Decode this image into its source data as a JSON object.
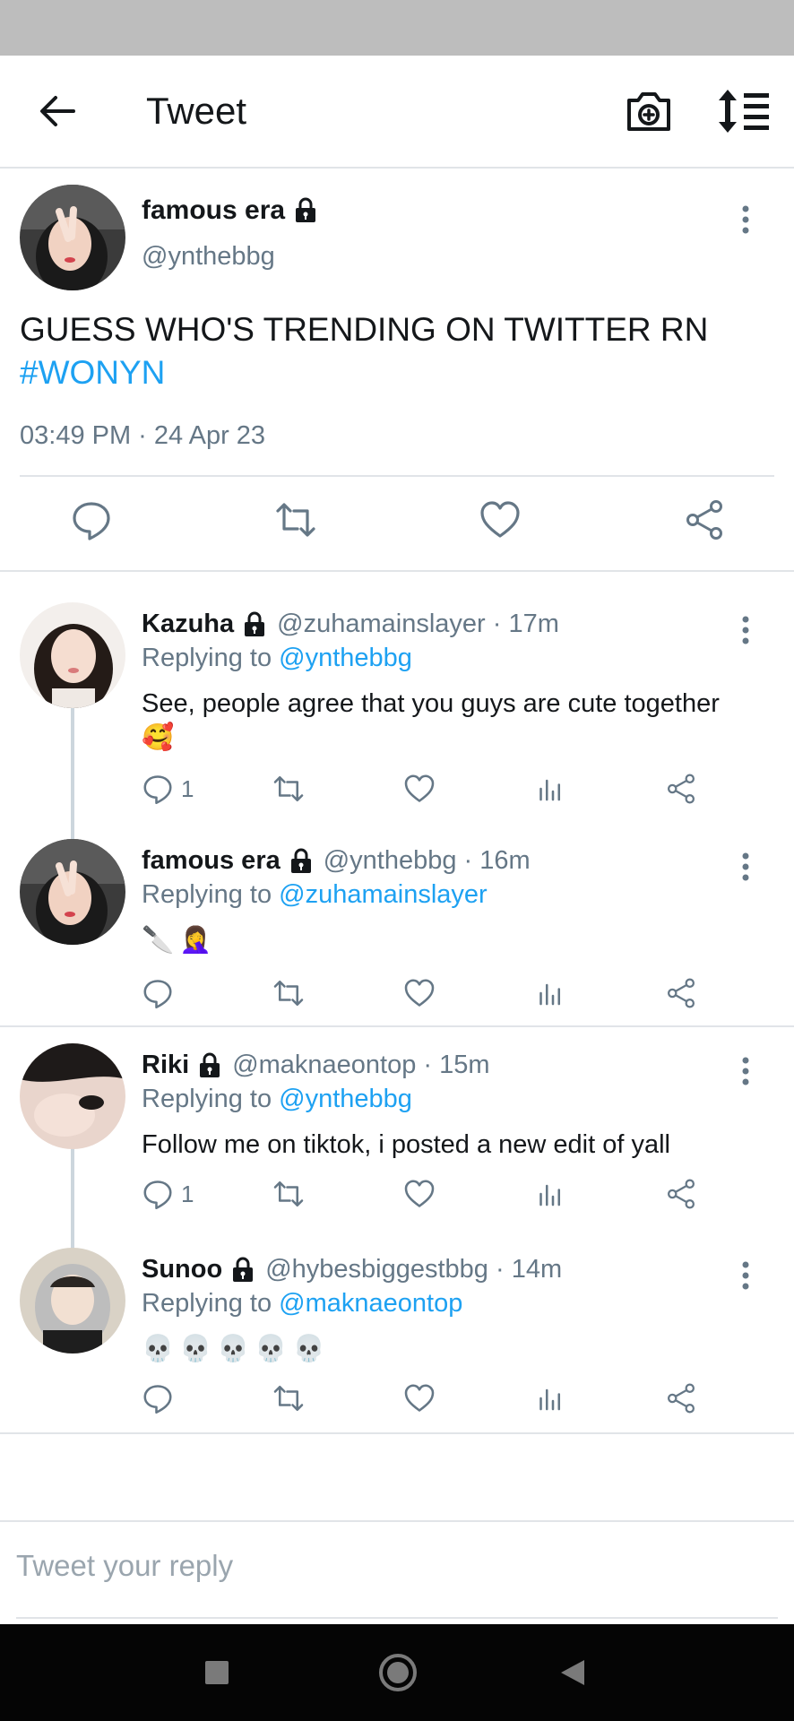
{
  "header": {
    "title": "Tweet"
  },
  "main_tweet": {
    "name": "famous era",
    "handle": "@ynthebbg",
    "text": "GUESS WHO'S TRENDING ON TWITTER RN",
    "hashtag": "#WONYN",
    "timestamp": "03:49 PM · 24 Apr 23"
  },
  "replies": [
    {
      "name": "Kazuha",
      "handle_time": "@zuhamainslayer · 17m",
      "replying_prefix": "Replying to ",
      "replying_to": "@ynthebbg",
      "text": "See, people agree that you guys are cute together",
      "emoji": "🥰",
      "reply_count": "1"
    },
    {
      "name": "famous era",
      "handle_time": "@ynthebbg · 16m",
      "replying_prefix": "Replying to ",
      "replying_to": "@zuhamainslayer",
      "emoji_1": "🔪",
      "emoji_2": "🤦‍♀️",
      "reply_count": ""
    },
    {
      "name": "Riki",
      "handle_time": "@maknaeontop · 15m",
      "replying_prefix": "Replying to ",
      "replying_to": "@ynthebbg",
      "text": "Follow me on tiktok, i posted a new edit of yall",
      "reply_count": "1"
    },
    {
      "name": "Sunoo",
      "handle_time": "@hybesbiggestbbg · 14m",
      "replying_prefix": "Replying to ",
      "replying_to": "@maknaeontop",
      "emoji": "💀",
      "reply_count": ""
    }
  ],
  "compose": {
    "placeholder": "Tweet your reply"
  },
  "icons": {
    "back": "arrow-left-icon",
    "camera": "camera-plus-icon",
    "sort": "sort-list-icon",
    "lock": "lock-icon",
    "more": "more-vertical-icon",
    "reply": "comment-icon",
    "retweet": "retweet-icon",
    "like": "heart-icon",
    "analytics": "bar-chart-icon",
    "share": "share-icon"
  },
  "colors": {
    "accent": "#1da1f2",
    "secondary_text": "#657786",
    "icon": "#657786",
    "divider": "#e1e4e8"
  }
}
